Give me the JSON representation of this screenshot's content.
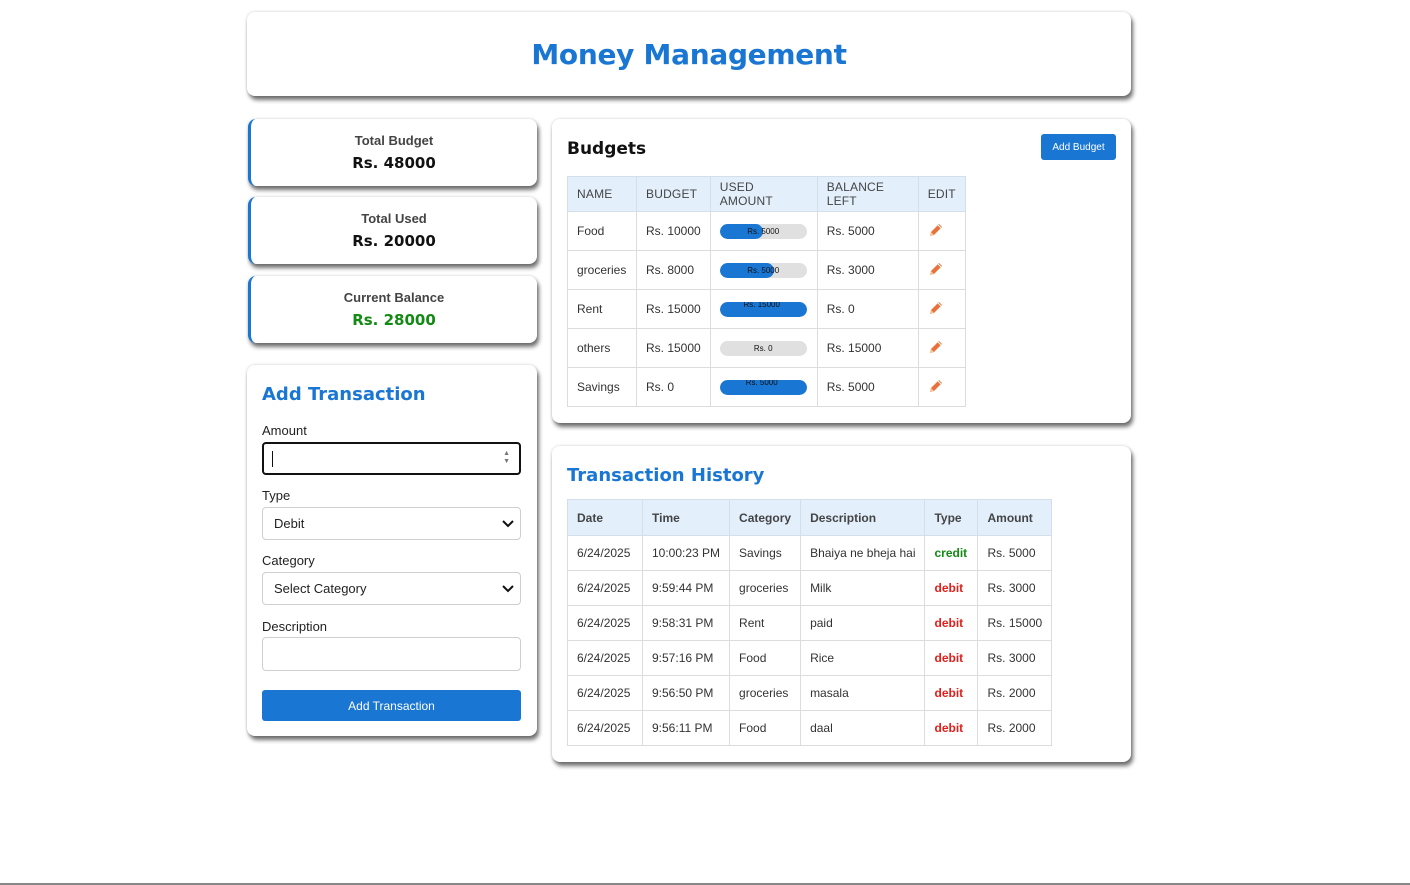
{
  "app": {
    "title": "Money Management"
  },
  "summary": [
    {
      "label": "Total Budget",
      "value": "Rs. 48000"
    },
    {
      "label": "Total Used",
      "value": "Rs. 20000"
    },
    {
      "label": "Current Balance",
      "value": "Rs. 28000"
    }
  ],
  "colors": {
    "accent": "#1976d2",
    "credit": "#138a13",
    "debit": "#e0201b",
    "edit_icon": "#e8733a"
  },
  "add_transaction": {
    "title": "Add Transaction",
    "amount_label": "Amount",
    "amount_value": "",
    "type_label": "Type",
    "type_value": "Debit",
    "category_label": "Category",
    "category_value": "Select Category",
    "description_label": "Description",
    "description_value": "",
    "submit_label": "Add Transaction"
  },
  "budgets": {
    "title": "Budgets",
    "add_button": "Add Budget",
    "columns": [
      "NAME",
      "BUDGET",
      "USED AMOUNT",
      "BALANCE LEFT",
      "EDIT"
    ],
    "rows": [
      {
        "name": "Food",
        "budget": "Rs. 10000",
        "used": "Rs. 5000",
        "used_fraction": 0.5,
        "balance": "Rs. 5000",
        "edit_icon": "pencil-icon"
      },
      {
        "name": "groceries",
        "budget": "Rs. 8000",
        "used": "Rs. 5000",
        "used_fraction": 0.625,
        "balance": "Rs. 3000",
        "edit_icon": "pencil-icon"
      },
      {
        "name": "Rent",
        "budget": "Rs. 15000",
        "used": "Rs. 15000",
        "used_fraction": 1.0,
        "balance": "Rs. 0",
        "edit_icon": "pencil-icon"
      },
      {
        "name": "others",
        "budget": "Rs. 15000",
        "used": "Rs. 0",
        "used_fraction": 0.0,
        "balance": "Rs. 15000",
        "edit_icon": "pencil-icon"
      },
      {
        "name": "Savings",
        "budget": "Rs. 0",
        "used": "Rs. 5000",
        "used_fraction": 1.0,
        "balance": "Rs. 5000",
        "edit_icon": "pencil-icon"
      }
    ]
  },
  "history": {
    "title": "Transaction History",
    "columns": [
      "Date",
      "Time",
      "Category",
      "Description",
      "Type",
      "Amount"
    ],
    "rows": [
      {
        "date": "6/24/2025",
        "time": "10:00:23 PM",
        "category": "Savings",
        "description": "Bhaiya ne bheja hai",
        "type": "credit",
        "amount": "Rs. 5000"
      },
      {
        "date": "6/24/2025",
        "time": "9:59:44 PM",
        "category": "groceries",
        "description": "Milk",
        "type": "debit",
        "amount": "Rs. 3000"
      },
      {
        "date": "6/24/2025",
        "time": "9:58:31 PM",
        "category": "Rent",
        "description": "paid",
        "type": "debit",
        "amount": "Rs. 15000"
      },
      {
        "date": "6/24/2025",
        "time": "9:57:16 PM",
        "category": "Food",
        "description": "Rice",
        "type": "debit",
        "amount": "Rs. 3000"
      },
      {
        "date": "6/24/2025",
        "time": "9:56:50 PM",
        "category": "groceries",
        "description": "masala",
        "type": "debit",
        "amount": "Rs. 2000"
      },
      {
        "date": "6/24/2025",
        "time": "9:56:11 PM",
        "category": "Food",
        "description": "daal",
        "type": "debit",
        "amount": "Rs. 2000"
      }
    ]
  }
}
